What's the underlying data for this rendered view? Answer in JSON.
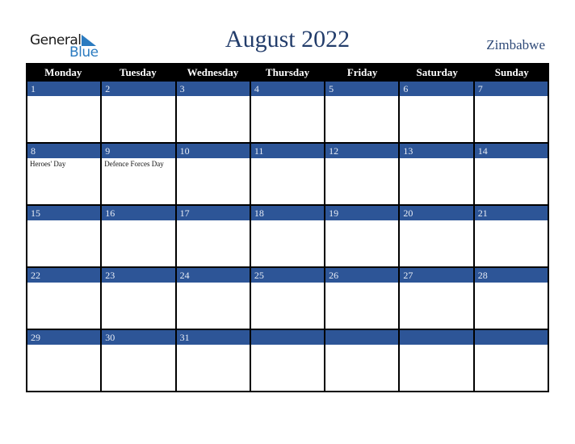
{
  "logo": {
    "line1": "General",
    "line2": "Blue",
    "accent_color": "#2b7bc0"
  },
  "title": "August 2022",
  "country": "Zimbabwe",
  "colors": {
    "header_bg": "#000000",
    "date_bar": "#2d5597",
    "title": "#233d6b"
  },
  "weekdays": [
    "Monday",
    "Tuesday",
    "Wednesday",
    "Thursday",
    "Friday",
    "Saturday",
    "Sunday"
  ],
  "weeks": [
    {
      "days": [
        {
          "date": "1",
          "event": ""
        },
        {
          "date": "2",
          "event": ""
        },
        {
          "date": "3",
          "event": ""
        },
        {
          "date": "4",
          "event": ""
        },
        {
          "date": "5",
          "event": ""
        },
        {
          "date": "6",
          "event": ""
        },
        {
          "date": "7",
          "event": ""
        }
      ]
    },
    {
      "days": [
        {
          "date": "8",
          "event": "Heroes' Day"
        },
        {
          "date": "9",
          "event": "Defence Forces Day"
        },
        {
          "date": "10",
          "event": ""
        },
        {
          "date": "11",
          "event": ""
        },
        {
          "date": "12",
          "event": ""
        },
        {
          "date": "13",
          "event": ""
        },
        {
          "date": "14",
          "event": ""
        }
      ]
    },
    {
      "days": [
        {
          "date": "15",
          "event": ""
        },
        {
          "date": "16",
          "event": ""
        },
        {
          "date": "17",
          "event": ""
        },
        {
          "date": "18",
          "event": ""
        },
        {
          "date": "19",
          "event": ""
        },
        {
          "date": "20",
          "event": ""
        },
        {
          "date": "21",
          "event": ""
        }
      ]
    },
    {
      "days": [
        {
          "date": "22",
          "event": ""
        },
        {
          "date": "23",
          "event": ""
        },
        {
          "date": "24",
          "event": ""
        },
        {
          "date": "25",
          "event": ""
        },
        {
          "date": "26",
          "event": ""
        },
        {
          "date": "27",
          "event": ""
        },
        {
          "date": "28",
          "event": ""
        }
      ]
    },
    {
      "days": [
        {
          "date": "29",
          "event": ""
        },
        {
          "date": "30",
          "event": ""
        },
        {
          "date": "31",
          "event": ""
        },
        {
          "date": "",
          "event": ""
        },
        {
          "date": "",
          "event": ""
        },
        {
          "date": "",
          "event": ""
        },
        {
          "date": "",
          "event": ""
        }
      ]
    }
  ]
}
